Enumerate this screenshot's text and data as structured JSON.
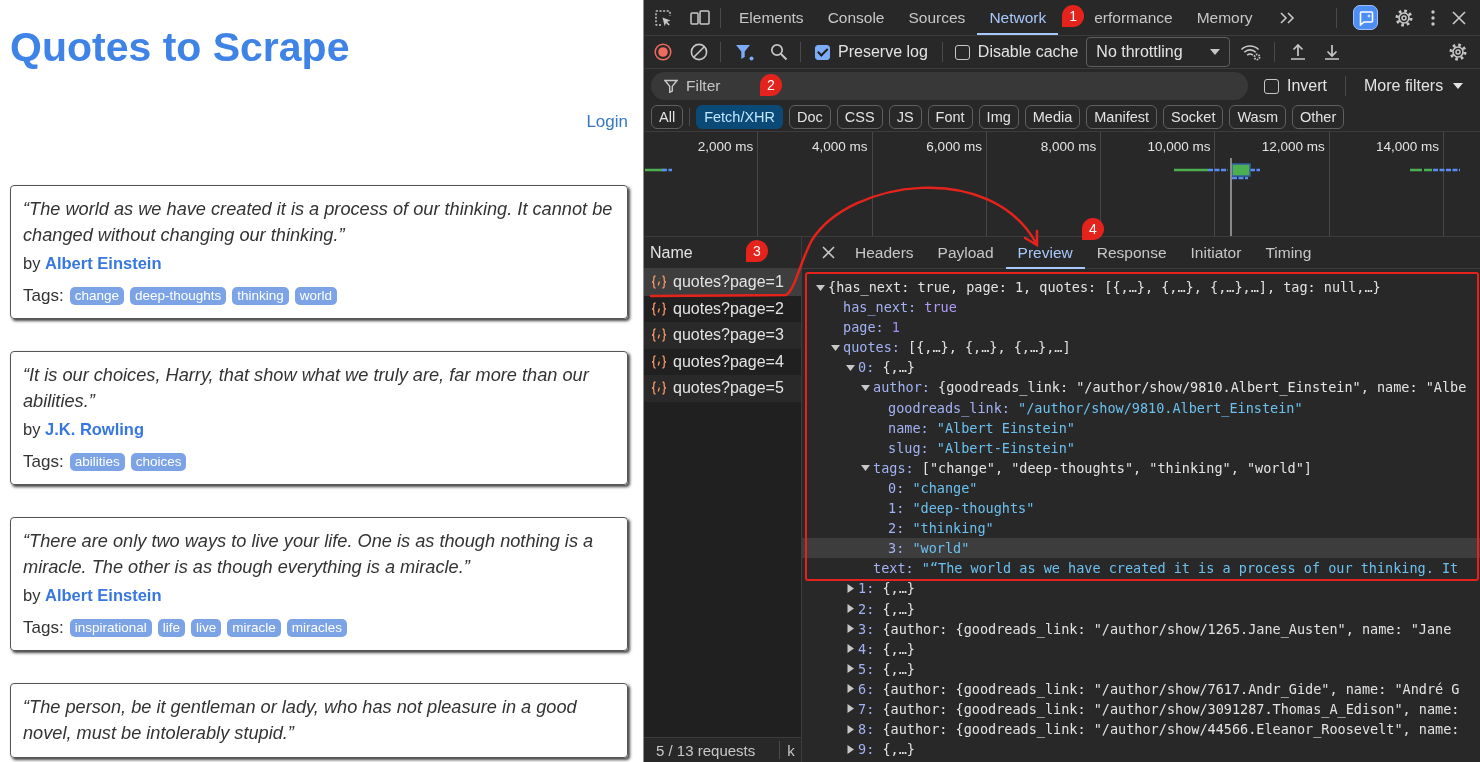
{
  "page": {
    "title": "Quotes to Scrape",
    "login": "Login",
    "quotes": [
      {
        "text": "“The world as we have created it is a process of our thinking. It cannot be changed without changing our thinking.”",
        "by": "by",
        "author": "Albert Einstein",
        "tags_label": "Tags:",
        "tags": [
          "change",
          "deep-thoughts",
          "thinking",
          "world"
        ]
      },
      {
        "text": "“It is our choices, Harry, that show what we truly are, far more than our abilities.”",
        "by": "by",
        "author": "J.K. Rowling",
        "tags_label": "Tags:",
        "tags": [
          "abilities",
          "choices"
        ]
      },
      {
        "text": "“There are only two ways to live your life. One is as though nothing is a miracle. The other is as though everything is a miracle.”",
        "by": "by",
        "author": "Albert Einstein",
        "tags_label": "Tags:",
        "tags": [
          "inspirational",
          "life",
          "live",
          "miracle",
          "miracles"
        ]
      },
      {
        "text": "“The person, be it gentleman or lady, who has not pleasure in a good novel, must be intolerably stupid.”"
      }
    ]
  },
  "devtools": {
    "tabs": [
      {
        "label": "Elements",
        "selected": false
      },
      {
        "label": "Console",
        "selected": false
      },
      {
        "label": "Sources",
        "selected": false
      },
      {
        "label": "Network",
        "selected": true
      },
      {
        "label": "erformance",
        "selected": false
      },
      {
        "label": "Memory",
        "selected": false
      }
    ],
    "toolbar": {
      "preserve_log": {
        "label": "Preserve log",
        "checked": true
      },
      "disable_cache": {
        "label": "Disable cache",
        "checked": false
      },
      "throttling": "No throttling"
    },
    "filter": {
      "placeholder": "Filter",
      "invert": {
        "label": "Invert",
        "checked": false
      },
      "more_filters": "More filters"
    },
    "type_filters": [
      {
        "label": "All",
        "selected": false
      },
      {
        "label": "Fetch/XHR",
        "selected": true
      },
      {
        "label": "Doc",
        "selected": false
      },
      {
        "label": "CSS",
        "selected": false
      },
      {
        "label": "JS",
        "selected": false
      },
      {
        "label": "Font",
        "selected": false
      },
      {
        "label": "Img",
        "selected": false
      },
      {
        "label": "Media",
        "selected": false
      },
      {
        "label": "Manifest",
        "selected": false
      },
      {
        "label": "Socket",
        "selected": false
      },
      {
        "label": "Wasm",
        "selected": false
      },
      {
        "label": "Other",
        "selected": false
      }
    ],
    "timeline": {
      "ticks": [
        "2,000 ms",
        "4,000 ms",
        "6,000 ms",
        "8,000 ms",
        "10,000 ms",
        "12,000 ms",
        "14,000 ms"
      ]
    },
    "requests": {
      "header": "Name",
      "rows": [
        {
          "name": "quotes?page=1",
          "selected": true
        },
        {
          "name": "quotes?page=2",
          "selected": false
        },
        {
          "name": "quotes?page=3",
          "selected": false
        },
        {
          "name": "quotes?page=4",
          "selected": false
        },
        {
          "name": "quotes?page=5",
          "selected": false
        }
      ],
      "status": "5 / 13 requests",
      "status_cut": "k"
    },
    "details": {
      "tabs": [
        {
          "label": "Headers",
          "selected": false
        },
        {
          "label": "Payload",
          "selected": false
        },
        {
          "label": "Preview",
          "selected": true
        },
        {
          "label": "Response",
          "selected": false
        },
        {
          "label": "Initiator",
          "selected": false
        },
        {
          "label": "Timing",
          "selected": false
        }
      ],
      "tree": {
        "value": "{has_next: true, page: 1, quotes: [{,…}, {,…}, {,…},…], tag: null,…}",
        "kind": "preview",
        "expanded": true,
        "selected": false,
        "children": [
          {
            "key": "has_next:",
            "value": "true",
            "kind": "bool",
            "selected": false
          },
          {
            "key": "page:",
            "value": "1",
            "kind": "number",
            "selected": false
          },
          {
            "key": "quotes:",
            "value": "[{,…}, {,…}, {,…},…]",
            "kind": "preview",
            "expanded": true,
            "selected": false,
            "children": [
              {
                "key": "0:",
                "value": "{,…}",
                "kind": "preview",
                "expanded": true,
                "selected": false,
                "children": [
                  {
                    "key": "author:",
                    "value": "{goodreads_link: \"/author/show/9810.Albert_Einstein\", name: \"Albe",
                    "kind": "preview",
                    "expanded": true,
                    "selected": false,
                    "children": [
                      {
                        "key": "goodreads_link:",
                        "value": "\"/author/show/9810.Albert_Einstein\"",
                        "kind": "string",
                        "selected": false
                      },
                      {
                        "key": "name:",
                        "value": "\"Albert Einstein\"",
                        "kind": "string",
                        "selected": false
                      },
                      {
                        "key": "slug:",
                        "value": "\"Albert-Einstein\"",
                        "kind": "string",
                        "selected": false
                      }
                    ]
                  },
                  {
                    "key": "tags:",
                    "value": "[\"change\", \"deep-thoughts\", \"thinking\", \"world\"]",
                    "kind": "preview",
                    "expanded": true,
                    "selected": false,
                    "children": [
                      {
                        "key": "0:",
                        "value": "\"change\"",
                        "kind": "string",
                        "selected": false
                      },
                      {
                        "key": "1:",
                        "value": "\"deep-thoughts\"",
                        "kind": "string",
                        "selected": false
                      },
                      {
                        "key": "2:",
                        "value": "\"thinking\"",
                        "kind": "string",
                        "selected": false
                      },
                      {
                        "key": "3:",
                        "value": "\"world\"",
                        "kind": "string",
                        "selected": true
                      }
                    ]
                  },
                  {
                    "key": "text:",
                    "value": "\"“The world as we have created it is a process of our thinking. It",
                    "kind": "string",
                    "selected": false
                  }
                ]
              },
              {
                "key": "1:",
                "value": "{,…}",
                "kind": "preview",
                "expanded": false,
                "selected": false
              },
              {
                "key": "2:",
                "value": "{,…}",
                "kind": "preview",
                "expanded": false,
                "selected": false
              },
              {
                "key": "3:",
                "value": "{author: {goodreads_link: \"/author/show/1265.Jane_Austen\", name: \"Jane",
                "kind": "preview",
                "expanded": false,
                "selected": false
              },
              {
                "key": "4:",
                "value": "{,…}",
                "kind": "preview",
                "expanded": false,
                "selected": false
              },
              {
                "key": "5:",
                "value": "{,…}",
                "kind": "preview",
                "expanded": false,
                "selected": false
              },
              {
                "key": "6:",
                "value": "{author: {goodreads_link: \"/author/show/7617.Andr_Gide\", name: \"André G",
                "kind": "preview",
                "expanded": false,
                "selected": false
              },
              {
                "key": "7:",
                "value": "{author: {goodreads_link: \"/author/show/3091287.Thomas_A_Edison\", name:",
                "kind": "preview",
                "expanded": false,
                "selected": false
              },
              {
                "key": "8:",
                "value": "{author: {goodreads_link: \"/author/show/44566.Eleanor_Roosevelt\", name:",
                "kind": "preview",
                "expanded": false,
                "selected": false
              },
              {
                "key": "9:",
                "value": "{,…}",
                "kind": "preview",
                "expanded": false,
                "selected": false
              }
            ]
          }
        ]
      }
    }
  },
  "annotations": {
    "steps": [
      "1",
      "2",
      "3",
      "4"
    ]
  }
}
